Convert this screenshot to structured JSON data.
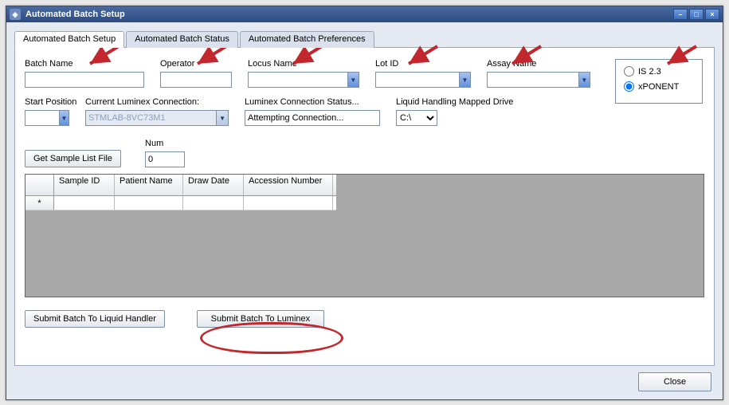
{
  "window": {
    "title": "Automated Batch Setup",
    "icon": "◈"
  },
  "tabs": [
    {
      "label": "Automated Batch Setup",
      "active": true
    },
    {
      "label": "Automated Batch Status",
      "active": false
    },
    {
      "label": "Automated Batch Preferences",
      "active": false
    }
  ],
  "fields": {
    "batch_name": {
      "label": "Batch Name",
      "value": ""
    },
    "operator": {
      "label": "Operator",
      "value": ""
    },
    "locus_name": {
      "label": "Locus Name",
      "value": ""
    },
    "lot_id": {
      "label": "Lot ID",
      "value": ""
    },
    "assay_name": {
      "label": "Assay Name",
      "value": ""
    },
    "start_position": {
      "label": "Start Position",
      "value": ""
    },
    "current_luminex_conn": {
      "label": "Current Luminex Connection:",
      "value": "STMLAB-8VC73M1"
    },
    "luminex_conn_status": {
      "label": "Luminex Connection Status...",
      "value": "Attempting Connection..."
    },
    "liquid_drive": {
      "label": "Liquid Handling Mapped Drive",
      "value": "C:\\"
    },
    "num": {
      "label": "Num",
      "value": "0"
    }
  },
  "platform": {
    "options": [
      "IS 2.3",
      "xPONENT"
    ],
    "selected": "xPONENT"
  },
  "buttons": {
    "get_sample_list": "Get Sample List File",
    "submit_liquid": "Submit Batch To Liquid Handler",
    "submit_luminex": "Submit Batch To Luminex",
    "close": "Close"
  },
  "grid": {
    "columns": [
      "Sample ID",
      "Patient Name",
      "Draw Date",
      "Accession Number"
    ],
    "rows": [
      {
        "marker": "*",
        "cells": [
          "",
          "",
          "",
          ""
        ]
      }
    ]
  }
}
